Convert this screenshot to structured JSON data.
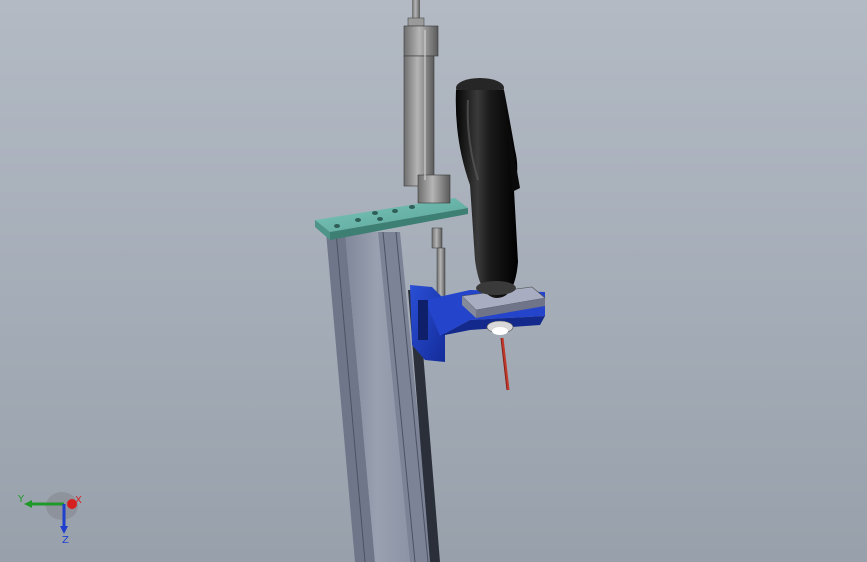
{
  "viewport": {
    "background_color": "#a9b0bb"
  },
  "model": {
    "parts": [
      {
        "name": "vertical-column",
        "color": "#8e95a6"
      },
      {
        "name": "top-mounting-plate",
        "color": "#6fb8ad"
      },
      {
        "name": "linear-rod",
        "color": "#8a8a8a"
      },
      {
        "name": "handle-grip",
        "color": "#1a1a1a"
      },
      {
        "name": "carriage-bracket",
        "color": "#1f3fc0"
      },
      {
        "name": "clamp-block",
        "color": "#9aa0b8"
      },
      {
        "name": "probe-tip",
        "color": "#c0392b"
      }
    ]
  },
  "triad": {
    "x_label": "X",
    "y_label": "Y",
    "z_label": "Z",
    "x_color": "#d62020",
    "y_color": "#1f9a2a",
    "z_color": "#1f3fcf"
  }
}
